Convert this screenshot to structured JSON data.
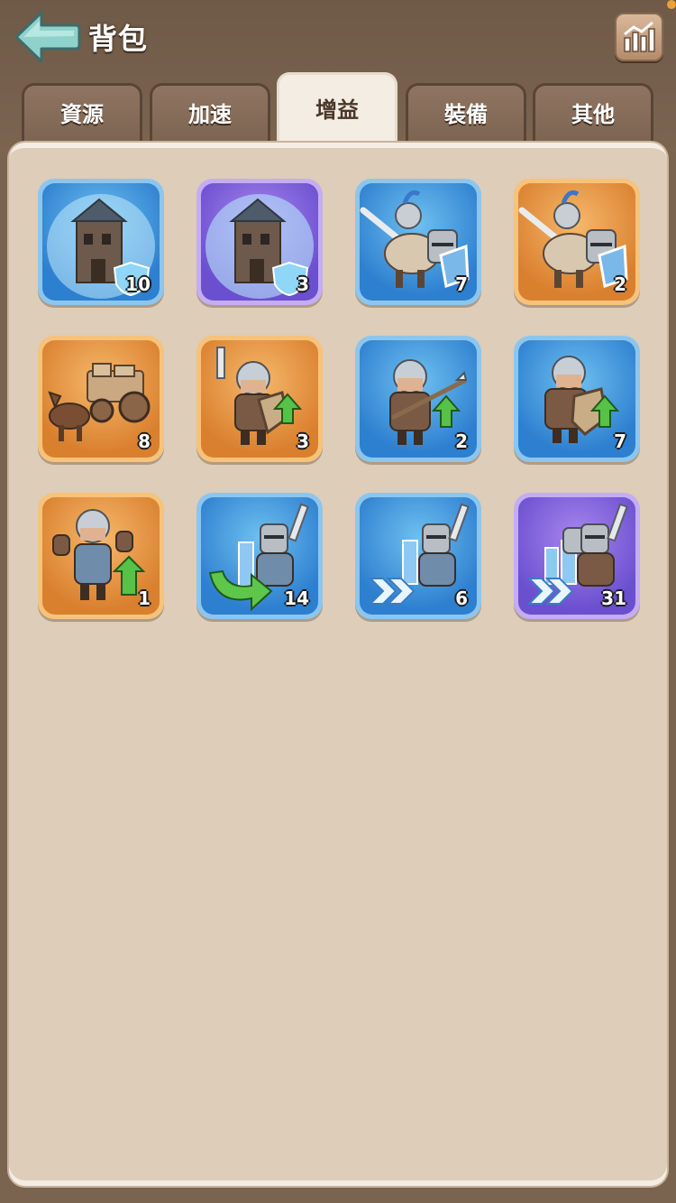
{
  "header": {
    "title": "背包",
    "back_icon": "back-arrow-icon",
    "stats_icon": "bar-chart-icon"
  },
  "tabs": [
    {
      "label": "資源",
      "active": false
    },
    {
      "label": "加速",
      "active": false
    },
    {
      "label": "增益",
      "active": true
    },
    {
      "label": "裝備",
      "active": false
    },
    {
      "label": "其他",
      "active": false
    }
  ],
  "colors": {
    "blue_frame": "#8cc6ee",
    "orange_frame": "#f7c27a",
    "purple_frame": "#c4adf2",
    "panel": "#ddcdb9",
    "active_tab": "#f3ede4"
  },
  "items": [
    {
      "icon": "city-shield-icon",
      "rarity": "blue",
      "count": "10"
    },
    {
      "icon": "city-shield-icon",
      "rarity": "purple",
      "count": "3"
    },
    {
      "icon": "knight-cavalry-icon",
      "rarity": "blue",
      "count": "7"
    },
    {
      "icon": "knight-cavalry-icon",
      "rarity": "orange",
      "count": "2"
    },
    {
      "icon": "supply-wagon-icon",
      "rarity": "orange",
      "count": "8"
    },
    {
      "icon": "swordsman-upgrade-icon",
      "rarity": "orange",
      "count": "3"
    },
    {
      "icon": "spearman-upgrade-icon",
      "rarity": "blue",
      "count": "2"
    },
    {
      "icon": "shieldman-upgrade-icon",
      "rarity": "blue",
      "count": "7"
    },
    {
      "icon": "soldier-upgrade-icon",
      "rarity": "orange",
      "count": "1"
    },
    {
      "icon": "troop-return-icon",
      "rarity": "blue",
      "count": "14"
    },
    {
      "icon": "troop-march-speed-icon",
      "rarity": "blue",
      "count": "6"
    },
    {
      "icon": "troop-march-speed-icon",
      "rarity": "purple",
      "count": "31"
    }
  ]
}
